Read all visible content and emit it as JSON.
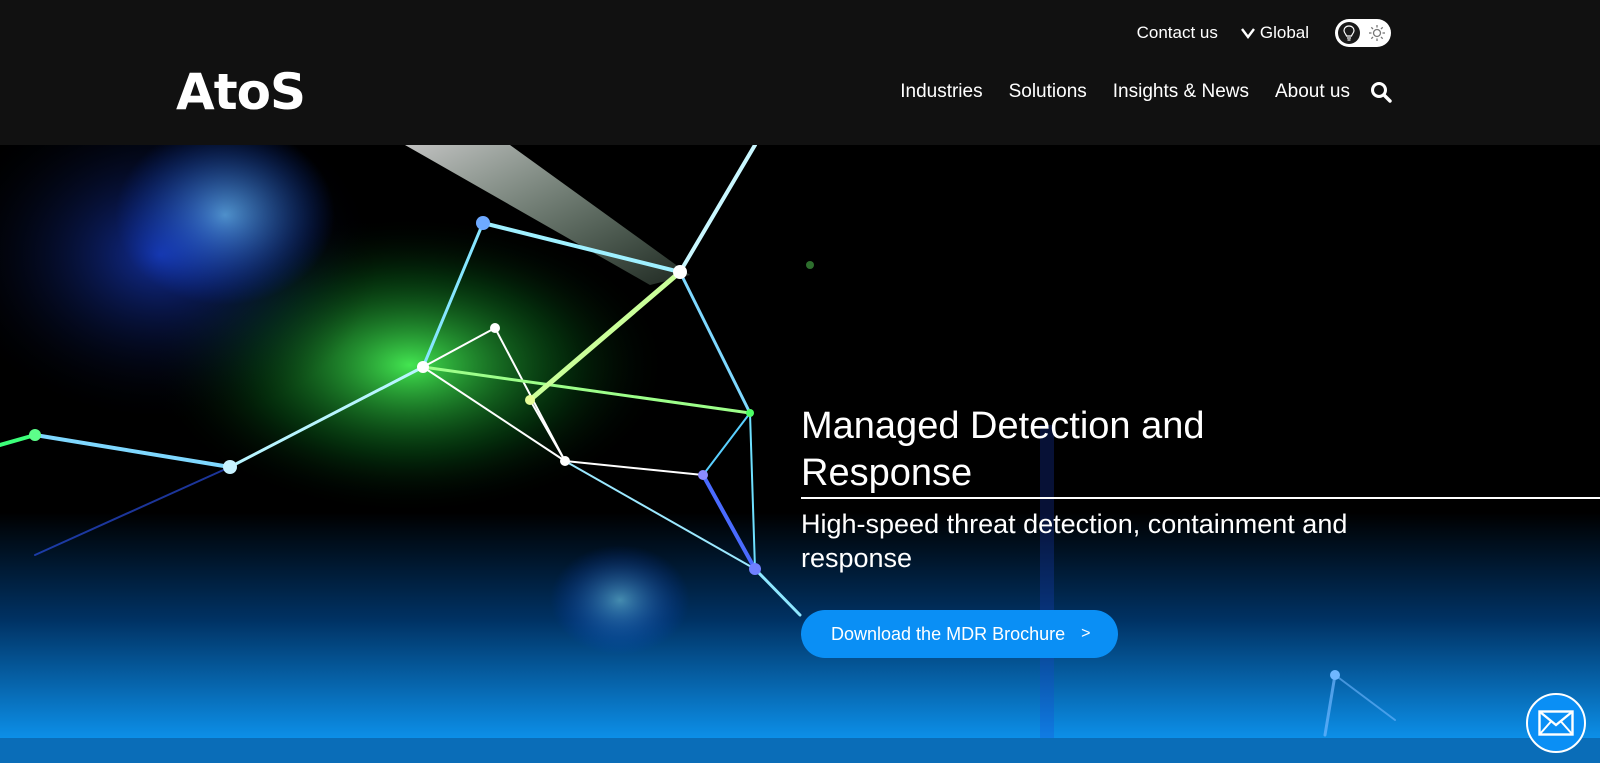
{
  "brand": {
    "logo_text": "AtoS"
  },
  "utility_nav": {
    "contact": "Contact us",
    "global": "Global",
    "theme_toggle": "dark-mode-toggle"
  },
  "main_nav": {
    "items": [
      {
        "label": "Industries"
      },
      {
        "label": "Solutions"
      },
      {
        "label": "Insights & News"
      },
      {
        "label": "About us"
      }
    ],
    "search_icon": "search-icon"
  },
  "hero": {
    "title": "Managed Detection and Response",
    "subtitle": "High-speed threat detection, containment and response",
    "cta_label": "Download the MDR Brochure",
    "cta_arrow": ">"
  },
  "icons": {
    "chevron": "chevron-down-icon",
    "lightbulb": "lightbulb-icon",
    "sun": "sun-icon",
    "search": "search-icon",
    "mail": "mail-icon"
  },
  "colors": {
    "header_bg": "#111111",
    "accent": "#0a8ff5",
    "hero_bottom": "#0c8fe8"
  }
}
